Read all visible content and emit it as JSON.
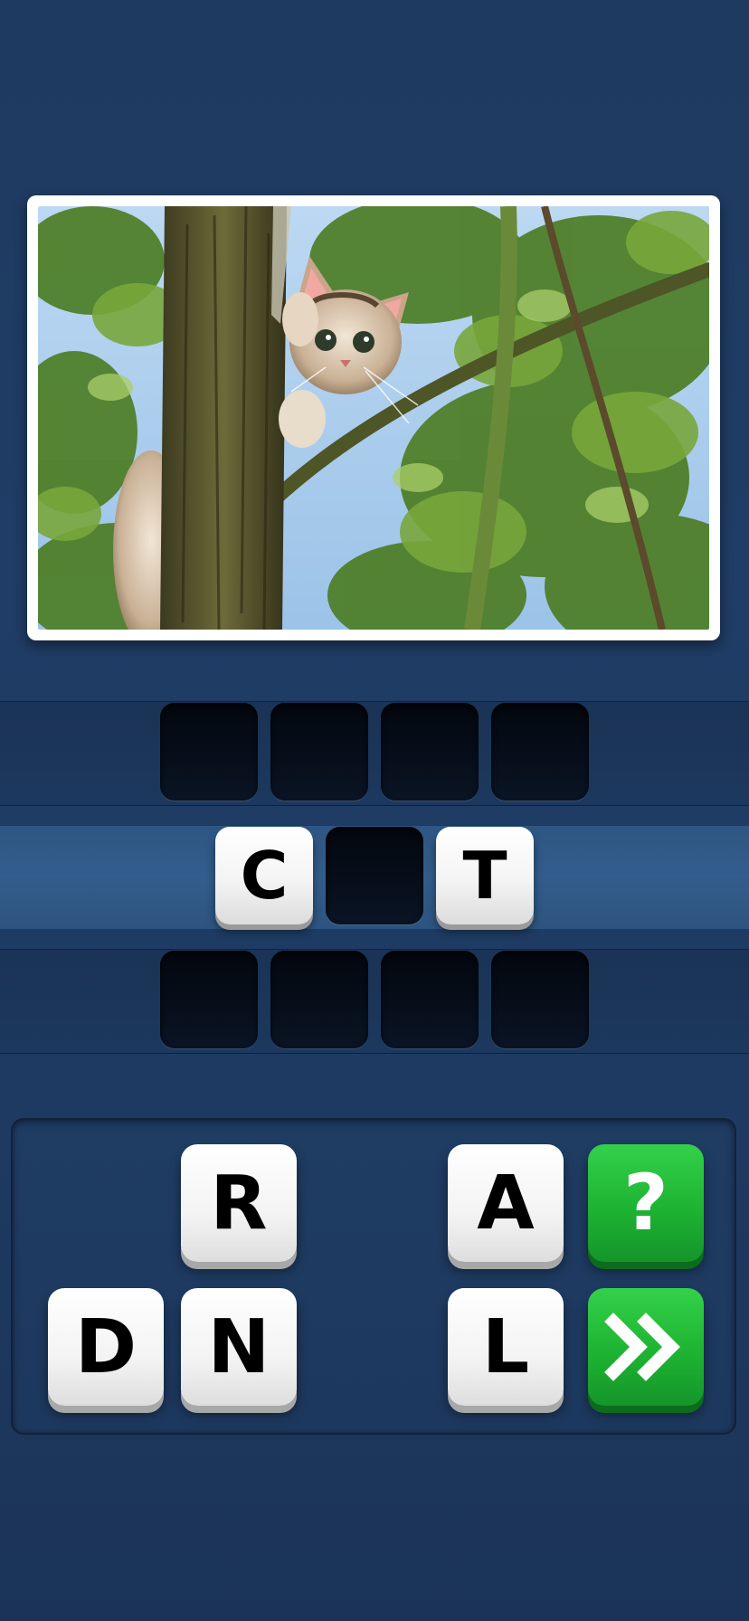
{
  "puzzle": {
    "image_subject": "kitten-in-tree",
    "rows": [
      {
        "slots": [
          "",
          "",
          "",
          ""
        ]
      },
      {
        "slots": [
          "C",
          "",
          "T"
        ]
      },
      {
        "slots": [
          "",
          "",
          "",
          ""
        ]
      }
    ]
  },
  "keyboard": {
    "letters": [
      "R",
      "A",
      "D",
      "N",
      "L"
    ],
    "hint_glyph": "?",
    "hint_icon": "question-mark-icon",
    "skip_icon": "double-chevron-right-icon"
  },
  "colors": {
    "background": "#1f3d66",
    "tile": "#ffffff",
    "slot_empty": "#050b16",
    "action_green": "#1eb332"
  }
}
